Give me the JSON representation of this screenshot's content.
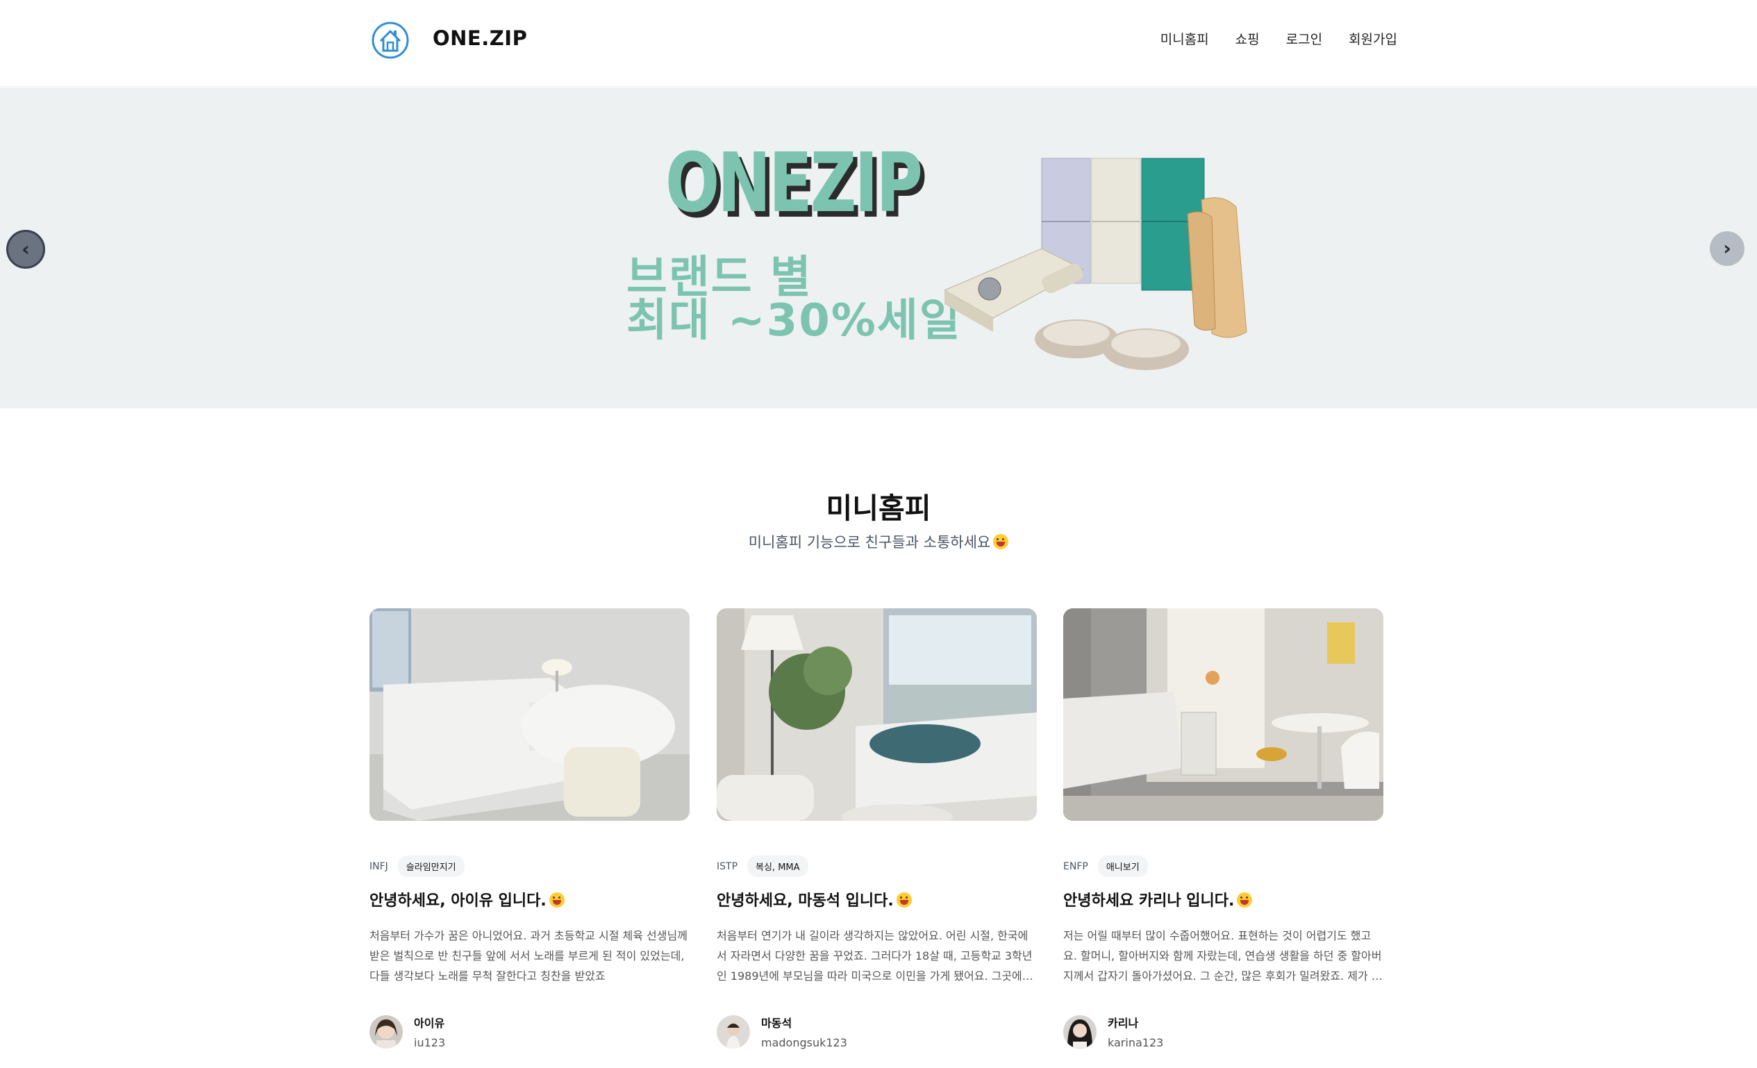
{
  "header": {
    "brand": "ONE.ZIP",
    "logo_icon": "house-circle-icon",
    "nav": [
      "미니홈피",
      "쇼핑",
      "로그인",
      "회원가입"
    ]
  },
  "hero": {
    "headline": "ONEZIP",
    "promo_line1": "브랜드 별",
    "promo_line2": "최대 ~30%세일",
    "prev_icon": "chevron-left-icon",
    "next_icon": "chevron-right-icon",
    "accent": "#7cc4b0"
  },
  "section": {
    "title": "미니홈피",
    "subtitle": "미니홈피 기능으로 친구들과 소통하세요"
  },
  "cards": [
    {
      "mbti": "INFJ",
      "hobby": "슬라임만지기",
      "title": "안녕하세요, 아이유 입니다.",
      "desc": "처음부터 가수가 꿈은 아니었어요. 과거 초등학교 시절 체육 선생님께 받은 벌칙으로 반 친구들 앞에 서서 노래를 부르게 된 적이 있었는데, 다들 생각보다 노래를 무척 잘한다고 칭찬을 받았죠",
      "author": "아이유",
      "author_id": "iu123"
    },
    {
      "mbti": "ISTP",
      "hobby": "복싱, MMA",
      "title": "안녕하세요, 마동석 입니다.",
      "desc": "처음부터 연기가 내 길이라 생각하지는 않았어요. 어린 시절, 한국에서 자라면서 다양한 꿈을 꾸었죠. 그러다가 18살 때, 고등학교 3학년인 1989년에 부모님을 따라 미국으로 이민을 가게 됐어요. 그곳에서 약...",
      "author": "마동석",
      "author_id": "madongsuk123"
    },
    {
      "mbti": "ENFP",
      "hobby": "애니보기",
      "title": "안녕하세요 카리나 입니다.",
      "desc": "저는 어릴 때부터 많이 수줍어했어요. 표현하는 것이 어렵기도 했고요. 할머니, 할아버지와 함께 자랐는데, 연습생 생활을 하던 중 할아버지께서 갑자기 돌아가셨어요. 그 순간, 많은 후회가 밀려왔죠. 제가 더 많은...",
      "author": "카리나",
      "author_id": "karina123"
    }
  ]
}
